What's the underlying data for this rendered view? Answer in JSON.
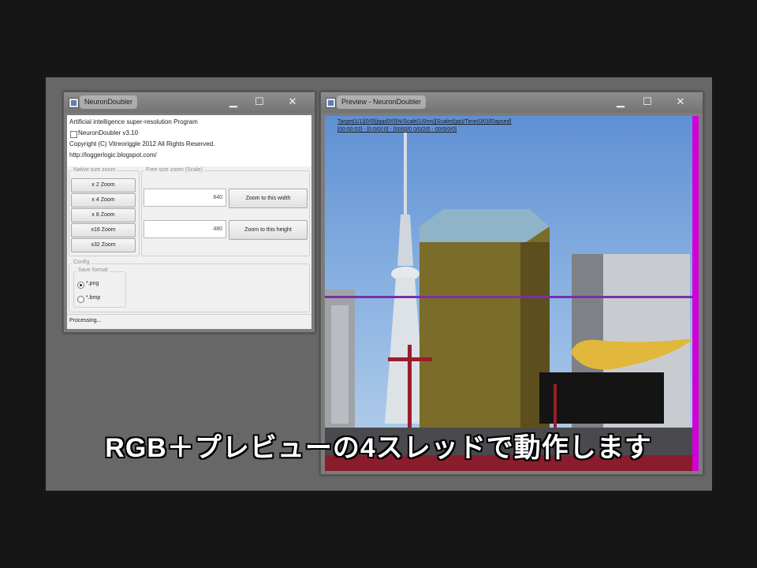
{
  "main_window": {
    "title": "NeuronDoubler",
    "about": {
      "line1": "Artificial intelligence super-resolution Program",
      "line2": "NeuronDoubler v3.10",
      "line3": "Copyright (C) Vitreoriggle 2012 All Rights Reserved.",
      "line4": "http://loggerlogic.blogspot.com/"
    },
    "native_zoom": {
      "label": "Native size zoom",
      "buttons": [
        "x 2 Zoom",
        "x 4 Zoom",
        "x 8 Zoom",
        "x16 Zoom",
        "x32 Zoom"
      ]
    },
    "free_zoom": {
      "label": "Free size zoom (Scale)",
      "width_value": "640",
      "height_value": "480",
      "fit_width_label": "Zoom to this width",
      "fit_height_label": "Zoom to this height"
    },
    "config": {
      "label": "Config",
      "save_format_label": "Save format",
      "options": [
        "*.png",
        "*.bmp"
      ],
      "selected": "*.png"
    },
    "status": "Processing..."
  },
  "preview_window": {
    "title": "Preview - NeuronDoubler",
    "info_line1": "Target(1/1)[0/0](ppp[0/0]%/Scale[1/0ms][Scaled(pp)/Time(0/0)/Elapsed]",
    "info_line2": "[00:00:03] - [0:0/0/:0] - [0000/0 0/0/2/0 - 00/0/0/0]"
  },
  "caption": "RGB＋プレビューの4スレッドで動作します",
  "window_buttons": {
    "minimize": "▁",
    "maximize": "☐",
    "close": "✕"
  },
  "colors": {
    "scan_line": "#7b2fa8",
    "scan_column": "#d100d8"
  }
}
